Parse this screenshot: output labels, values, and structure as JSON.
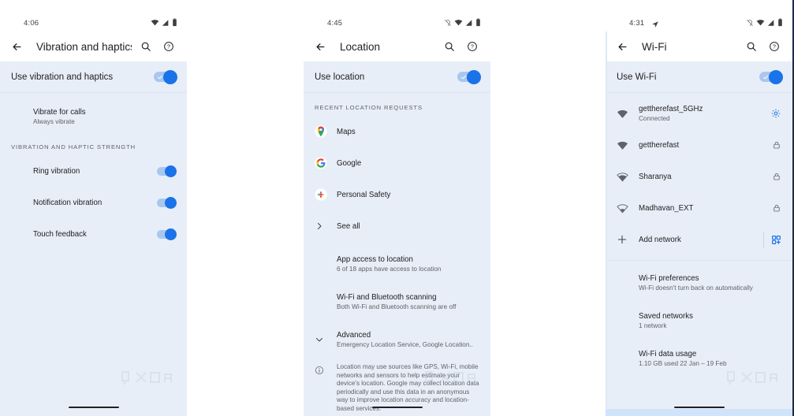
{
  "colors": {
    "accent": "#1a73e8",
    "toggle_track": "#a8c7f0",
    "panel_bg": "#e8eef7",
    "appbar_bg": "#ffffff",
    "text_primary": "#202124",
    "text_secondary": "#5f6368",
    "divider": "#dbe3ef",
    "panel3_border": "#1b2a4a"
  },
  "watermark": "XDA",
  "panels": [
    {
      "id": "vibration-and-haptics",
      "status": {
        "time": "4:06",
        "icons": [
          "wifi-icon",
          "signal-icon",
          "battery-icon"
        ],
        "has_location_off": false,
        "has_nav_arrow": false
      },
      "appbar": {
        "back": "back-arrow-icon",
        "title": "Vibration and haptics",
        "actions": [
          "search-icon",
          "help-icon"
        ]
      },
      "master": {
        "label": "Use vibration and haptics",
        "state": "on"
      },
      "rows": [
        {
          "title": "Vibrate for calls",
          "subtitle": "Always vibrate",
          "lead": "none",
          "trail": "none"
        }
      ],
      "section_header": "VIBRATION AND HAPTIC STRENGTH",
      "strength_rows": [
        {
          "title": "Ring vibration",
          "state": "on"
        },
        {
          "title": "Notification vibration",
          "state": "on"
        },
        {
          "title": "Touch feedback",
          "state": "on"
        }
      ]
    },
    {
      "id": "location",
      "status": {
        "time": "4:45",
        "icons": [
          "location-off-icon",
          "wifi-icon",
          "signal-icon",
          "battery-icon"
        ],
        "has_location_off": true,
        "has_nav_arrow": false
      },
      "appbar": {
        "back": "back-arrow-icon",
        "title": "Location",
        "actions": [
          "search-icon",
          "help-icon"
        ]
      },
      "master": {
        "label": "Use location",
        "state": "on"
      },
      "section_header": "RECENT LOCATION REQUESTS",
      "apps": [
        {
          "title": "Maps",
          "icon": "google-maps-icon"
        },
        {
          "title": "Google",
          "icon": "google-g-icon"
        },
        {
          "title": "Personal Safety",
          "icon": "personal-safety-icon"
        },
        {
          "title": "See all",
          "icon": "chevron-right-icon"
        }
      ],
      "settings_rows": [
        {
          "title": "App access to location",
          "subtitle": "6 of 18 apps have access to location",
          "lead": "none"
        },
        {
          "title": "Wi-Fi and Bluetooth scanning",
          "subtitle": "Both Wi-Fi and Bluetooth scanning are off",
          "lead": "none"
        },
        {
          "title": "Advanced",
          "subtitle": "Emergency Location Service, Google Location..",
          "lead": "chevron-down-icon"
        }
      ],
      "legal": {
        "icon": "info-icon",
        "text": "Location may use sources like GPS, Wi-Fi, mobile networks and sensors to help estimate your device's location. Google may collect location data periodically and use this data in an anonymous way to improve location accuracy and location-based services."
      }
    },
    {
      "id": "wi-fi",
      "status": {
        "time": "4:31",
        "icons": [
          "nav-arrow-icon",
          "location-off-icon",
          "wifi-icon",
          "signal-icon",
          "battery-icon"
        ],
        "has_location_off": true,
        "has_nav_arrow": true
      },
      "appbar": {
        "back": "back-arrow-icon",
        "title": "Wi-Fi",
        "actions": [
          "search-icon",
          "help-icon"
        ]
      },
      "master": {
        "label": "Use Wi-Fi",
        "state": "on"
      },
      "networks": [
        {
          "ssid": "gettherefast_5GHz",
          "subtitle": "Connected",
          "signal": 4,
          "trail": "gear-icon"
        },
        {
          "ssid": "gettherefast",
          "subtitle": "",
          "signal": 4,
          "trail": "lock-icon"
        },
        {
          "ssid": "Sharanya",
          "subtitle": "",
          "signal": 3,
          "trail": "lock-icon"
        },
        {
          "ssid": "Madhavan_EXT",
          "subtitle": "",
          "signal": 2,
          "trail": "lock-icon"
        }
      ],
      "add_network": {
        "title": "Add network",
        "lead": "plus-icon",
        "trail": "qr-scan-icon"
      },
      "settings_rows": [
        {
          "title": "Wi-Fi preferences",
          "subtitle": "Wi-Fi doesn't turn back on automatically"
        },
        {
          "title": "Saved networks",
          "subtitle": "1 network"
        },
        {
          "title": "Wi-Fi data usage",
          "subtitle": "1.10 GB used 22 Jan – 19 Feb"
        }
      ]
    }
  ]
}
